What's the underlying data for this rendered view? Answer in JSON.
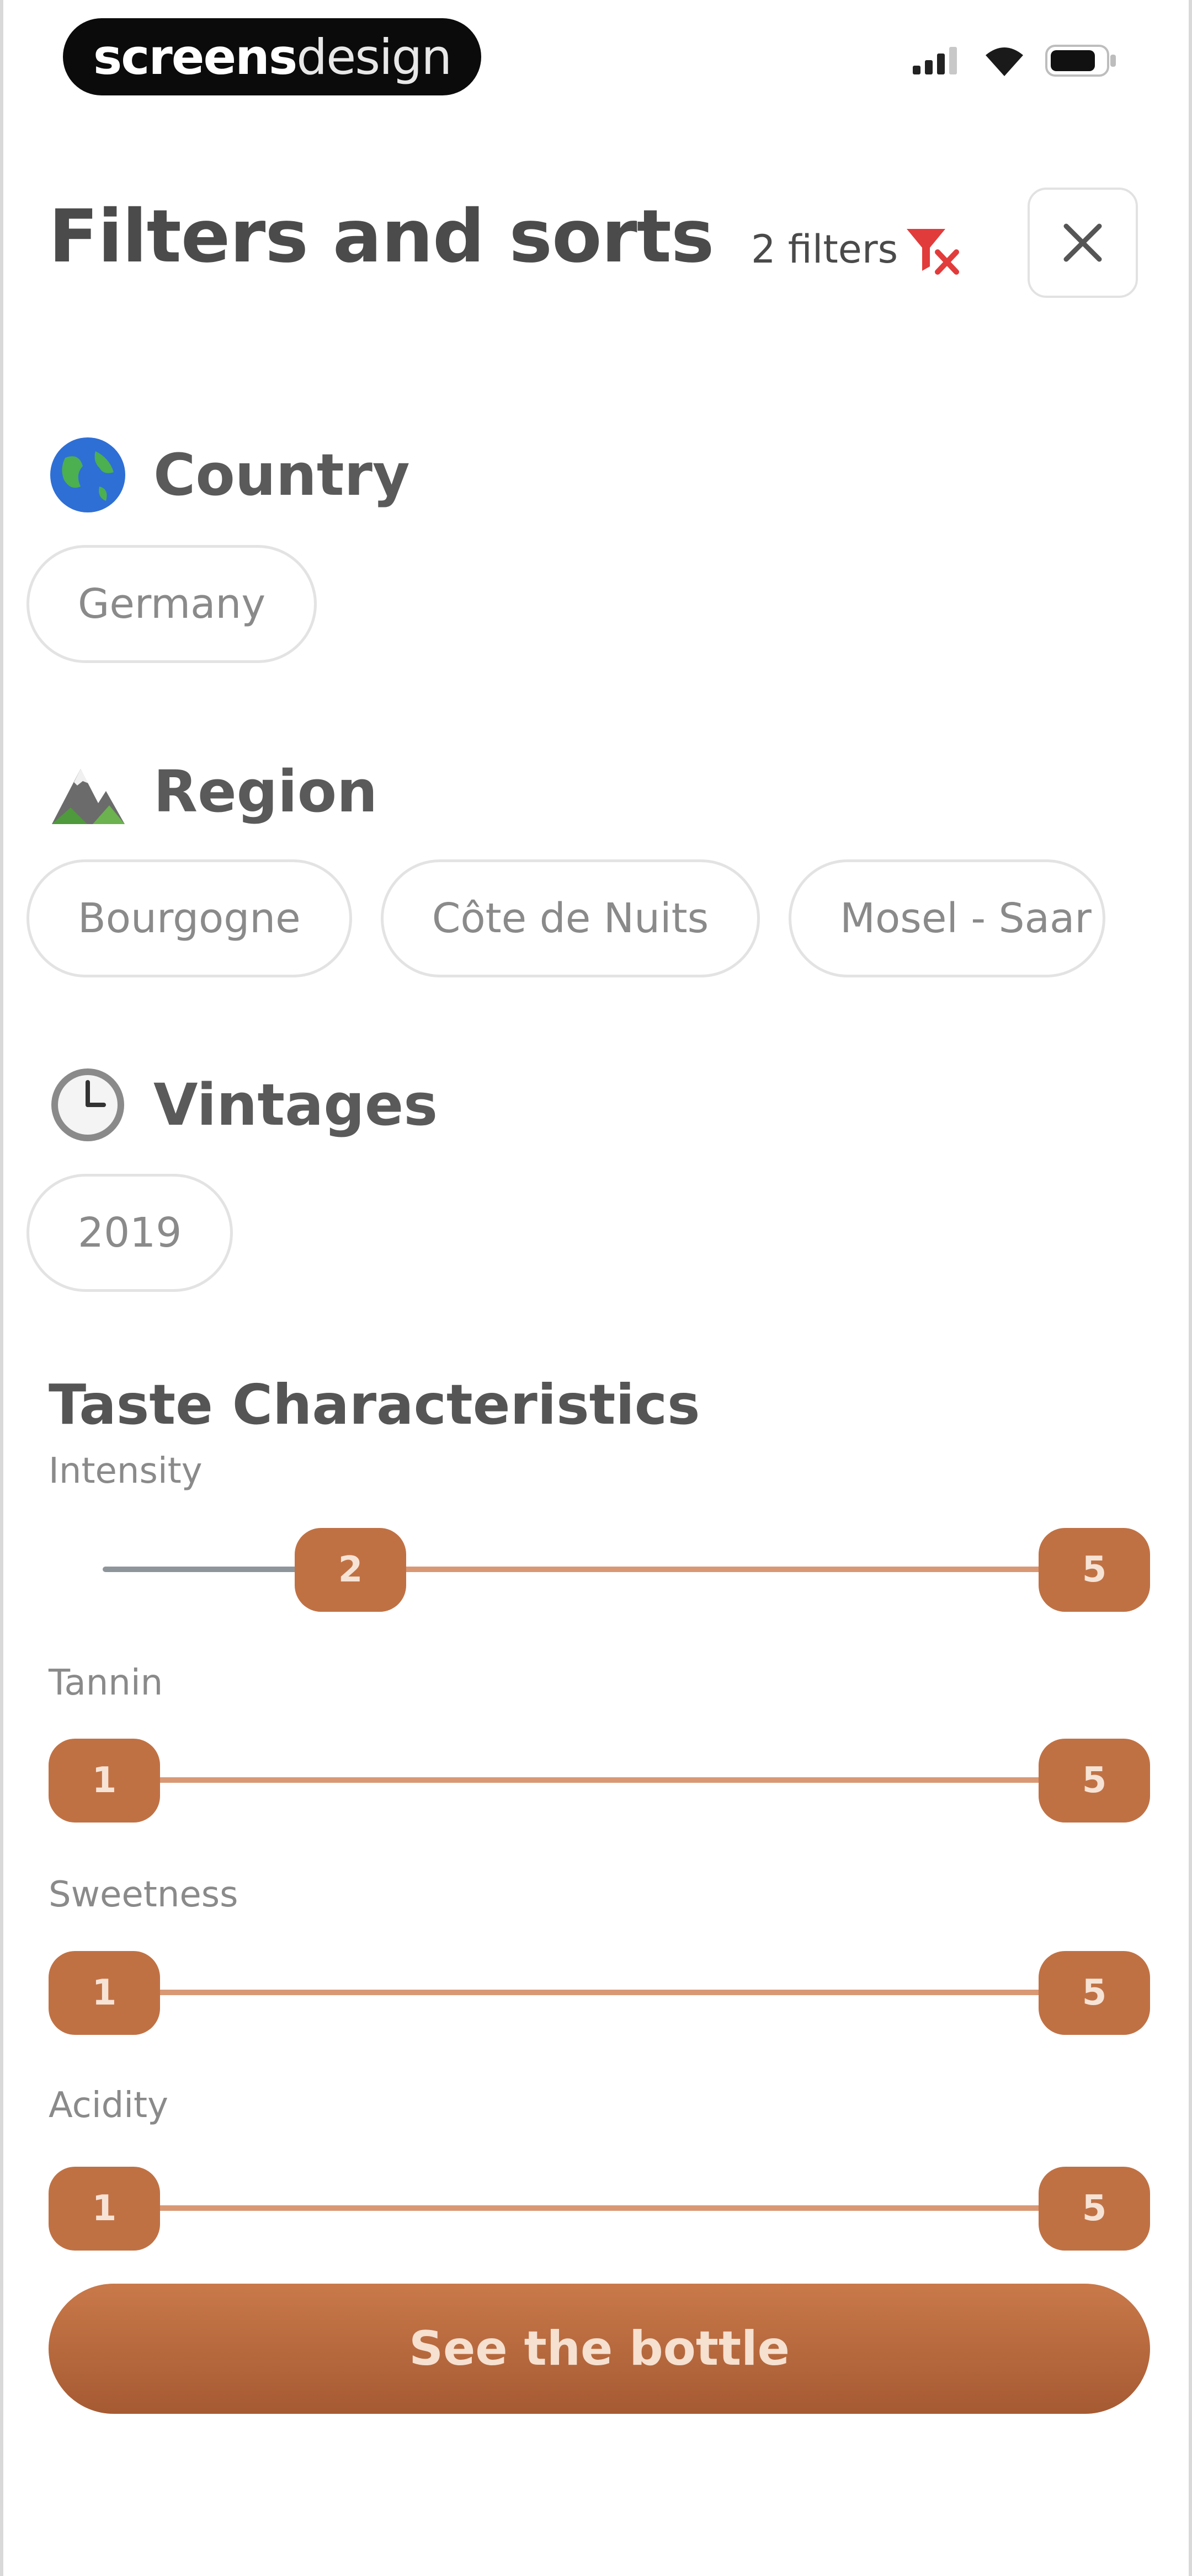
{
  "status_bar": {
    "brand_bold": "screens",
    "brand_light": "design"
  },
  "header": {
    "title": "Filters and sorts",
    "filter_count": "2 filters",
    "close_label": "×"
  },
  "sections": {
    "country": {
      "label": "Country",
      "icon": "globe-icon",
      "options": [
        "Germany"
      ]
    },
    "region": {
      "label": "Region",
      "icon": "mountain-icon",
      "options": [
        "Bourgogne",
        "Côte de Nuits",
        "Mosel - Saar"
      ]
    },
    "vintages": {
      "label": "Vintages",
      "icon": "clock-icon",
      "options": [
        "2019"
      ]
    }
  },
  "taste": {
    "title": "Taste Characteristics",
    "sliders": [
      {
        "label": "Intensity",
        "min": "2",
        "max": "5"
      },
      {
        "label": "Tannin",
        "min": "1",
        "max": "5"
      },
      {
        "label": "Sweetness",
        "min": "1",
        "max": "5"
      },
      {
        "label": "Acidity",
        "min": "1",
        "max": "5"
      }
    ]
  },
  "cta": {
    "label": "See the bottle"
  },
  "colors": {
    "accent": "#c07144",
    "track_fill": "#d99874",
    "track_base": "#8f969b",
    "badge_red": "#e23b3b"
  }
}
